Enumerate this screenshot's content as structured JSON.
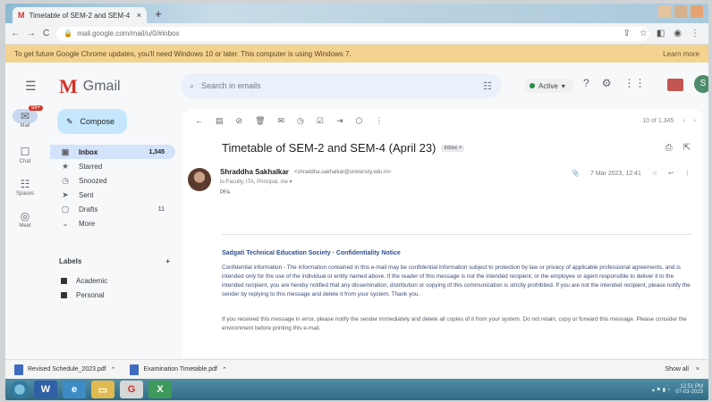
{
  "browser": {
    "tab_title": "Timetable of SEM-2 and SEM-4",
    "tab_close": "×",
    "new_tab": "+",
    "address": "mail.google.com/mail/u/0/#inbox",
    "back": "←",
    "forward": "→",
    "reload": "C",
    "infobar_text": "To get future Google Chrome updates, you'll need Windows 10 or later. This computer is using Windows 7.",
    "infobar_link": "Learn more"
  },
  "gmail": {
    "logo_m": "M",
    "logo_word": "Gmail",
    "search_placeholder": "Search in emails",
    "status": "Active",
    "compose": "Compose",
    "nav": [
      {
        "icon": "▣",
        "label": "Inbox",
        "count": "1,345",
        "active": true
      },
      {
        "icon": "★",
        "label": "Starred",
        "count": ""
      },
      {
        "icon": "◷",
        "label": "Snoozed",
        "count": ""
      },
      {
        "icon": "➤",
        "label": "Sent",
        "count": ""
      },
      {
        "icon": "▢",
        "label": "Drafts",
        "count": "11"
      },
      {
        "icon": "⌄",
        "label": "More",
        "count": ""
      }
    ],
    "labels_title": "Labels",
    "labels_add": "+",
    "labels": [
      "Academic",
      "Personal"
    ],
    "rail": [
      {
        "icon": "✉",
        "label": "Mail",
        "badge": "99+"
      },
      {
        "icon": "☐",
        "label": "Chat"
      },
      {
        "icon": "☷",
        "label": "Spaces"
      },
      {
        "icon": "◎",
        "label": "Meet"
      }
    ]
  },
  "message": {
    "pager": "10 of 1,345",
    "subject": "Timetable of SEM-2 and SEM-4 (April 23)",
    "subject_chip": "Inbox ×",
    "sender_name": "Shraddha Sakhalkar",
    "sender_email": "<shraddha.sakhalkar@university.edu.in>",
    "to_line": "to Faculty, ITA, Principal, me ▾",
    "date": "7 Mar 2023, 12:41",
    "body_preview": "PFA",
    "disclaimer_heading": "Sadgati Technical Education Society · Confidentiality Notice",
    "disclaimer_text": "Confidential information - The information contained in this e-mail may be confidential information subject to protection by law or privacy of applicable professional agreements, and is intended only for the use of the individual or entity named above. If the reader of this message is not the intended recipient, or the employee or agent responsible to deliver it to the intended recipient, you are hereby notified that any dissemination, distribution or copying of this communication is strictly prohibited. If you are not the intended recipient, please notify the sender by replying to this message and delete it from your system. Thank you.",
    "footer_text": "If you received this message in error, please notify the sender immediately and delete all copies of it from your system. Do not retain, copy or forward this message. Please consider the environment before printing this e-mail."
  },
  "downloads": [
    {
      "name": "Revised Schedule_2023.pdf"
    },
    {
      "name": "Examination Timetable.pdf"
    }
  ],
  "downloads_show_all": "Show all",
  "downloads_close": "×",
  "taskbar": {
    "clock_time": "12:51 PM",
    "clock_date": "07-03-2023"
  }
}
